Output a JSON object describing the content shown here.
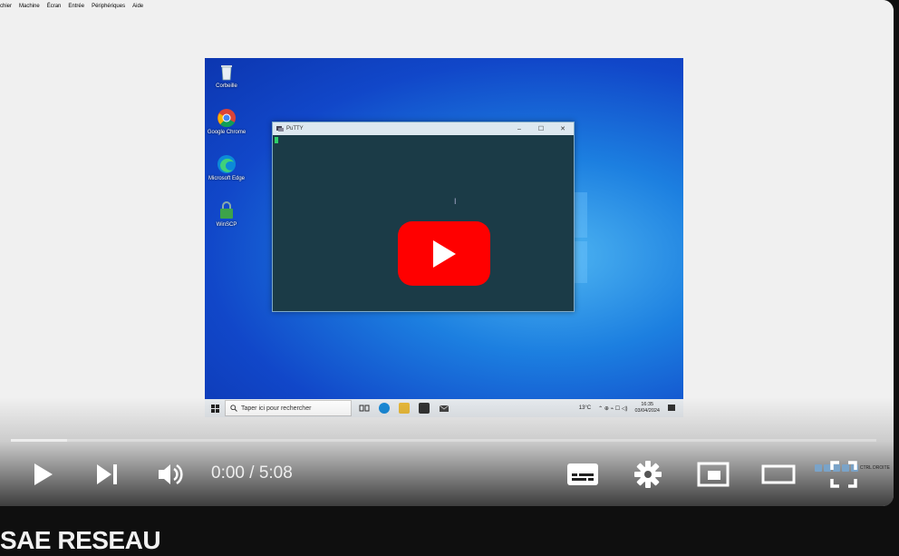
{
  "vbox_menu": [
    "chier",
    "Machine",
    "Écran",
    "Entrée",
    "Périphériques",
    "Aide"
  ],
  "desktop_icons": [
    {
      "label": "Corbeille",
      "icon": "recycle-bin-icon"
    },
    {
      "label": "Google Chrome",
      "icon": "chrome-icon"
    },
    {
      "label": "Microsoft Edge",
      "icon": "edge-icon"
    },
    {
      "label": "WinSCP",
      "icon": "winscp-icon"
    }
  ],
  "putty": {
    "title": "PuTTY",
    "minimize": "–",
    "maximize": "☐",
    "close": "✕"
  },
  "taskbar": {
    "search_placeholder": "Taper ici pour rechercher",
    "weather": "13°C",
    "clock_time": "16:35",
    "clock_date": "03/04/2024"
  },
  "vbox_status": {
    "host_key": "CTRL DROITE"
  },
  "player": {
    "time": "0:00 / 5:08",
    "progress": 0,
    "buffered": 0.065,
    "accent": "#ff0000"
  },
  "video": {
    "title": "SAE RESEAU"
  }
}
